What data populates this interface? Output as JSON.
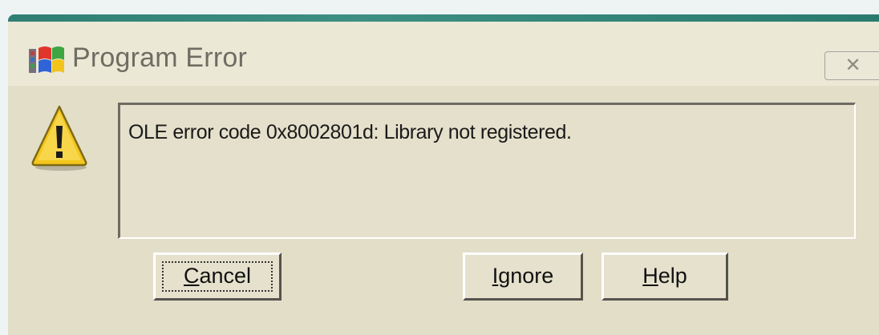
{
  "window": {
    "title": "Program Error",
    "close_glyph": "✕",
    "app_icon": "windows-flag-icon"
  },
  "message": {
    "icon": "warning-icon",
    "text": "OLE error code 0x8002801d: Library not registered."
  },
  "buttons": {
    "cancel": {
      "mnemonic": "C",
      "rest": "ancel",
      "focused": true
    },
    "ignore": {
      "mnemonic": "I",
      "rest": "gnore"
    },
    "help": {
      "mnemonic": "H",
      "rest": "elp"
    }
  },
  "colors": {
    "dialog_bg": "#e5e1cc",
    "title_accent": "#2f7f75",
    "warning_yellow": "#f4c61c"
  }
}
